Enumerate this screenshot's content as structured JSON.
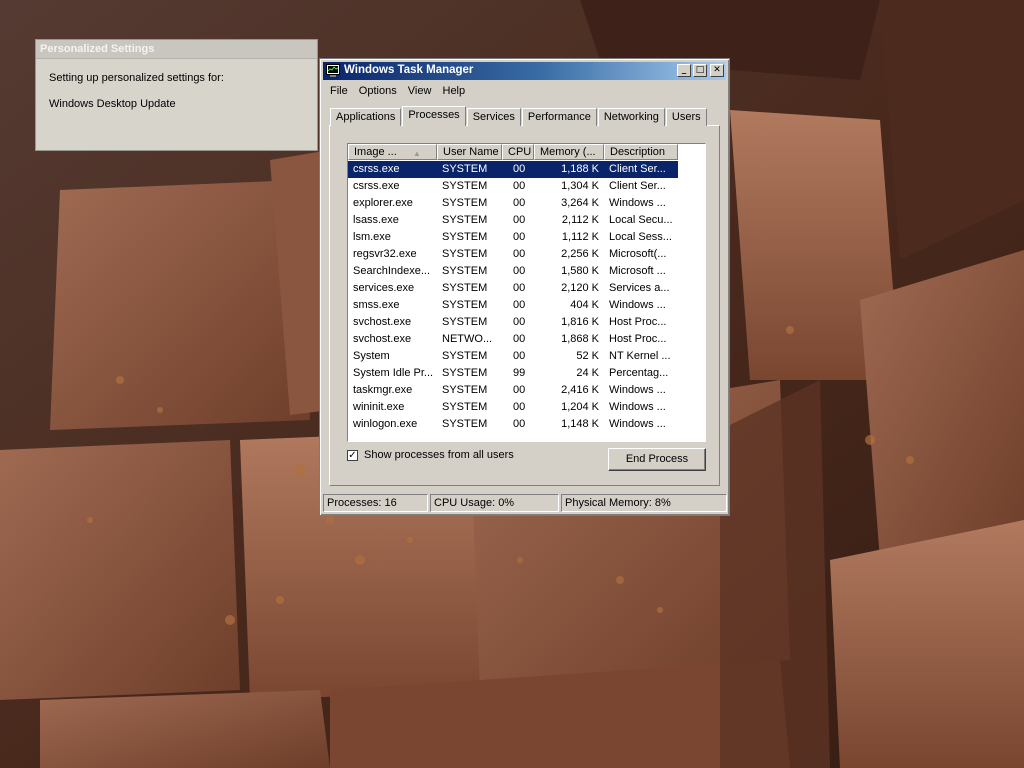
{
  "personalized_settings": {
    "title": "Personalized Settings",
    "line1": "Setting up personalized settings for:",
    "line2": "Windows Desktop Update"
  },
  "task_manager": {
    "title": "Windows Task Manager",
    "caption_buttons": {
      "minimize": "_",
      "maximize": "□",
      "close": "✕"
    },
    "menu": [
      "File",
      "Options",
      "View",
      "Help"
    ],
    "tabs": [
      "Applications",
      "Processes",
      "Services",
      "Performance",
      "Networking",
      "Users"
    ],
    "active_tab": "Processes",
    "columns": [
      "Image ...",
      "User Name",
      "CPU",
      "Memory (...",
      "Description"
    ],
    "sort_indicator": "▲",
    "processes": [
      {
        "name": "csrss.exe",
        "user": "SYSTEM",
        "cpu": "00",
        "memory": "1,188 K",
        "description": "Client Ser..."
      },
      {
        "name": "csrss.exe",
        "user": "SYSTEM",
        "cpu": "00",
        "memory": "1,304 K",
        "description": "Client Ser..."
      },
      {
        "name": "explorer.exe",
        "user": "SYSTEM",
        "cpu": "00",
        "memory": "3,264 K",
        "description": "Windows ..."
      },
      {
        "name": "lsass.exe",
        "user": "SYSTEM",
        "cpu": "00",
        "memory": "2,112 K",
        "description": "Local Secu..."
      },
      {
        "name": "lsm.exe",
        "user": "SYSTEM",
        "cpu": "00",
        "memory": "1,112 K",
        "description": "Local Sess..."
      },
      {
        "name": "regsvr32.exe",
        "user": "SYSTEM",
        "cpu": "00",
        "memory": "2,256 K",
        "description": "Microsoft(..."
      },
      {
        "name": "SearchIndexe...",
        "user": "SYSTEM",
        "cpu": "00",
        "memory": "1,580 K",
        "description": "Microsoft ..."
      },
      {
        "name": "services.exe",
        "user": "SYSTEM",
        "cpu": "00",
        "memory": "2,120 K",
        "description": "Services a..."
      },
      {
        "name": "smss.exe",
        "user": "SYSTEM",
        "cpu": "00",
        "memory": "404 K",
        "description": "Windows ..."
      },
      {
        "name": "svchost.exe",
        "user": "SYSTEM",
        "cpu": "00",
        "memory": "1,816 K",
        "description": "Host Proc..."
      },
      {
        "name": "svchost.exe",
        "user": "NETWO...",
        "cpu": "00",
        "memory": "1,868 K",
        "description": "Host Proc..."
      },
      {
        "name": "System",
        "user": "SYSTEM",
        "cpu": "00",
        "memory": "52 K",
        "description": "NT Kernel ..."
      },
      {
        "name": "System Idle Pr...",
        "user": "SYSTEM",
        "cpu": "99",
        "memory": "24 K",
        "description": "Percentag..."
      },
      {
        "name": "taskmgr.exe",
        "user": "SYSTEM",
        "cpu": "00",
        "memory": "2,416 K",
        "description": "Windows ..."
      },
      {
        "name": "wininit.exe",
        "user": "SYSTEM",
        "cpu": "00",
        "memory": "1,204 K",
        "description": "Windows ..."
      },
      {
        "name": "winlogon.exe",
        "user": "SYSTEM",
        "cpu": "00",
        "memory": "1,148 K",
        "description": "Windows ..."
      }
    ],
    "selected_row": 0,
    "show_all_label": "Show processes from all users",
    "show_all_checked": "✓",
    "end_process_label": "End Process",
    "status": {
      "processes": "Processes: 16",
      "cpu": "CPU Usage: 0%",
      "memory": "Physical Memory: 8%"
    }
  },
  "colors": {
    "title_bar_start": "#0a246a",
    "title_bar_end": "#a6caf0",
    "selection": "#0a246a",
    "window_face": "#d4d0c8"
  }
}
